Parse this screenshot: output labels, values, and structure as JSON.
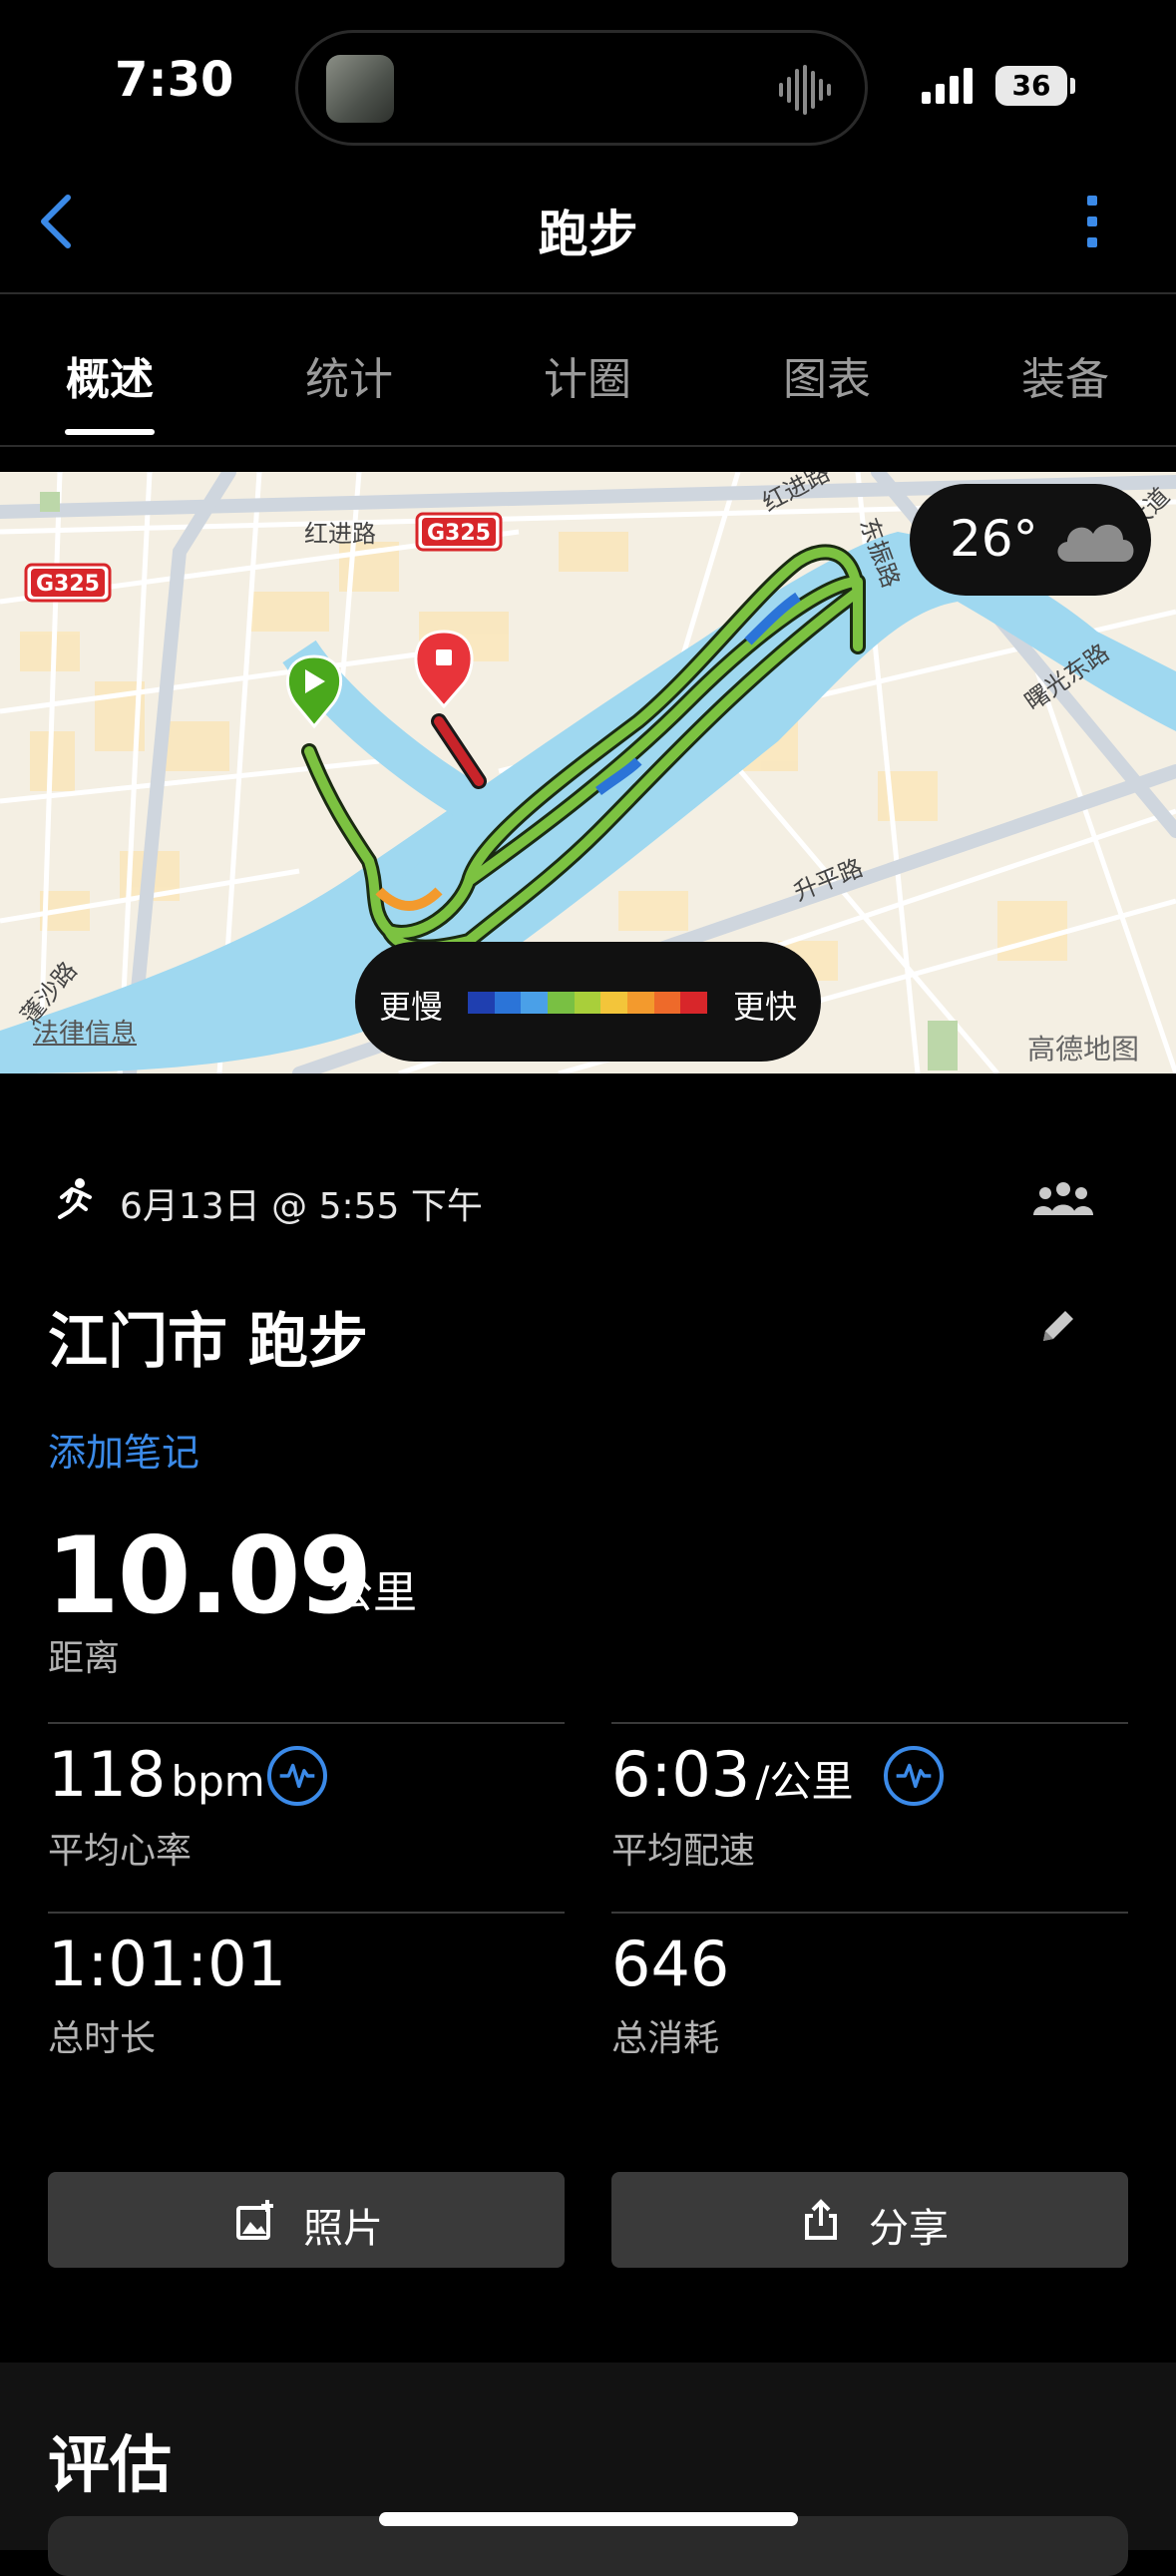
{
  "status_bar": {
    "time": "7:30",
    "battery": "36"
  },
  "nav": {
    "title": "跑步"
  },
  "tabs": [
    {
      "label": "概述"
    },
    {
      "label": "统计"
    },
    {
      "label": "计圈"
    },
    {
      "label": "图表"
    },
    {
      "label": "装备"
    }
  ],
  "map": {
    "weather_temp": "26°",
    "legend_slow": "更慢",
    "legend_fast": "更快",
    "legend_colors": [
      "#1f3fb0",
      "#2b74d8",
      "#4aa0e8",
      "#79c043",
      "#a9cf3a",
      "#f3c53a",
      "#f39a2d",
      "#ee6a2a",
      "#d8262a"
    ],
    "legal_link": "法律信息",
    "brand": "高德地图",
    "labels": {
      "road1": "红进路",
      "road2": "红进路",
      "highway1": "G325",
      "highway2": "G325",
      "road3": "东振路",
      "road4": "曙光东路",
      "road5": "升平路",
      "road6": "蓬沙路",
      "road7": "大道"
    }
  },
  "activity": {
    "datetime": "6月13日 @ 5:55 下午",
    "title": "江门市 跑步",
    "add_note": "添加笔记",
    "distance": {
      "value": "10.09",
      "unit": "公里",
      "label": "距离"
    },
    "heart_rate": {
      "value": "118",
      "unit": "bpm",
      "label": "平均心率"
    },
    "pace": {
      "value": "6:03",
      "unit": "/公里",
      "label": "平均配速"
    },
    "duration": {
      "value": "1:01:01",
      "label": "总时长"
    },
    "calories": {
      "value": "646",
      "label": "总消耗"
    }
  },
  "buttons": {
    "photos": "照片",
    "share": "分享"
  },
  "evaluation": {
    "title": "评估"
  }
}
